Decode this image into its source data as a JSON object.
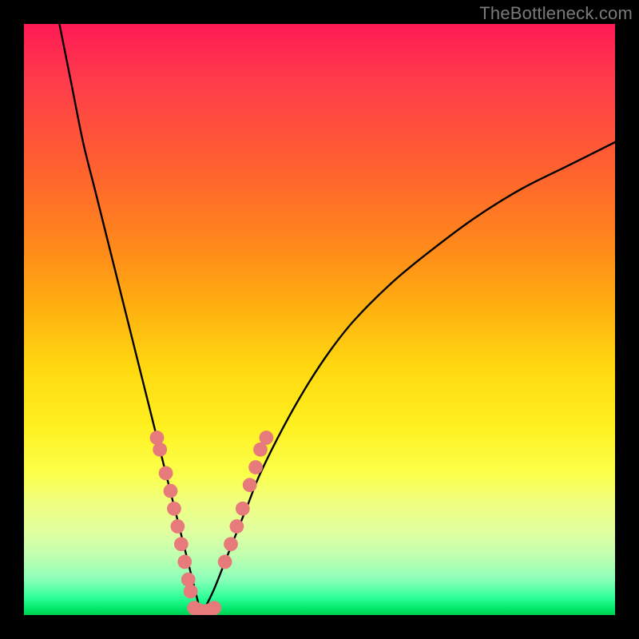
{
  "watermark": "TheBottleneck.com",
  "chart_data": {
    "type": "line",
    "title": "",
    "xlabel": "",
    "ylabel": "",
    "xlim": [
      0,
      100
    ],
    "ylim": [
      0,
      100
    ],
    "grid": false,
    "series": [
      {
        "name": "left-branch",
        "x": [
          6,
          8,
          10,
          12,
          14,
          16,
          18,
          19,
          20,
          21,
          22,
          23,
          24,
          25,
          26,
          27,
          28,
          29,
          30
        ],
        "y": [
          100,
          90,
          80,
          72,
          64,
          56,
          48,
          44,
          40,
          36,
          32,
          28,
          24,
          20,
          16,
          12,
          8,
          4,
          0
        ]
      },
      {
        "name": "right-branch",
        "x": [
          30,
          32,
          34,
          36,
          38,
          40,
          44,
          48,
          52,
          56,
          62,
          68,
          76,
          84,
          92,
          100
        ],
        "y": [
          0,
          4,
          9,
          14,
          19,
          24,
          32,
          39,
          45,
          50,
          56,
          61,
          67,
          72,
          76,
          80
        ]
      }
    ],
    "markers": [
      {
        "name": "left-dot-cluster",
        "points": [
          [
            22.5,
            30
          ],
          [
            23.0,
            28
          ],
          [
            24.0,
            24
          ],
          [
            24.8,
            21
          ],
          [
            25.4,
            18
          ],
          [
            26.0,
            15
          ],
          [
            26.6,
            12
          ],
          [
            27.2,
            9
          ],
          [
            27.8,
            6
          ],
          [
            28.2,
            4
          ]
        ]
      },
      {
        "name": "right-dot-cluster",
        "points": [
          [
            34.0,
            9
          ],
          [
            35.0,
            12
          ],
          [
            36.0,
            15
          ],
          [
            37.0,
            18
          ],
          [
            38.2,
            22
          ],
          [
            39.2,
            25
          ],
          [
            40.0,
            28
          ],
          [
            41.0,
            30
          ]
        ]
      },
      {
        "name": "bottom-dot-cluster",
        "points": [
          [
            28.8,
            1.2
          ],
          [
            29.6,
            0.8
          ],
          [
            30.5,
            0.6
          ],
          [
            31.4,
            0.8
          ],
          [
            32.2,
            1.2
          ]
        ]
      }
    ],
    "marker_color": "#e77a7a",
    "marker_radius_pct": 1.2,
    "curve_stroke": "#000000"
  }
}
